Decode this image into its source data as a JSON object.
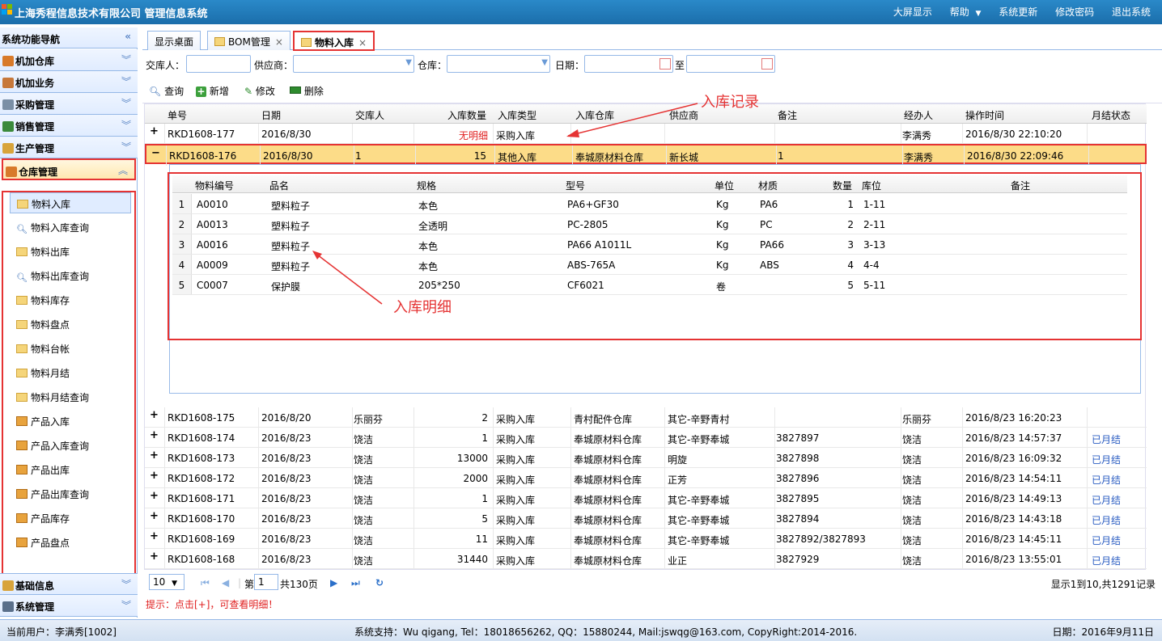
{
  "app": {
    "title": "上海秀程信息技术有限公司 管理信息系统",
    "menu": [
      "大屏显示",
      "帮助",
      "系统更新",
      "修改密码",
      "退出系统"
    ]
  },
  "sidebar": {
    "header": "系统功能导航",
    "collapse_glyph": "«",
    "categories": [
      {
        "label": "机加仓库",
        "icon": "house-icon",
        "color": "#d87a2a"
      },
      {
        "label": "机加业务",
        "icon": "wrench-icon",
        "color": "#c7783a"
      },
      {
        "label": "采购管理",
        "icon": "cart-icon",
        "color": "#7a8fa6"
      },
      {
        "label": "销售管理",
        "icon": "sales-icon",
        "color": "#3b8a3b"
      },
      {
        "label": "生产管理",
        "icon": "production-icon",
        "color": "#d8a43b"
      },
      {
        "label": "仓库管理",
        "icon": "warehouse-icon",
        "color": "#d87a2a"
      }
    ],
    "items": [
      {
        "label": "物料入库",
        "icon": "folder-icon"
      },
      {
        "label": "物料入库查询",
        "icon": "magnifier-icon"
      },
      {
        "label": "物料出库",
        "icon": "folder-icon"
      },
      {
        "label": "物料出库查询",
        "icon": "magnifier-icon"
      },
      {
        "label": "物料库存",
        "icon": "folder-icon"
      },
      {
        "label": "物料盘点",
        "icon": "folder-icon"
      },
      {
        "label": "物料台帐",
        "icon": "folder-icon"
      },
      {
        "label": "物料月结",
        "icon": "folder-icon"
      },
      {
        "label": "物料月结查询",
        "icon": "folder-icon"
      },
      {
        "label": "产品入库",
        "icon": "product-icon"
      },
      {
        "label": "产品入库查询",
        "icon": "product-icon"
      },
      {
        "label": "产品出库",
        "icon": "product-icon"
      },
      {
        "label": "产品出库查询",
        "icon": "product-icon"
      },
      {
        "label": "产品库存",
        "icon": "product-icon"
      },
      {
        "label": "产品盘点",
        "icon": "product-icon"
      }
    ],
    "bottom_categories": [
      {
        "label": "基础信息",
        "icon": "key-icon",
        "color": "#d8a43b"
      },
      {
        "label": "系统管理",
        "icon": "monitor-icon",
        "color": "#5a6f8a"
      }
    ]
  },
  "tabs": [
    {
      "label": "显示桌面",
      "closable": false
    },
    {
      "label": "BOM管理",
      "closable": true
    },
    {
      "label": "物料入库",
      "closable": true
    }
  ],
  "filters": {
    "deliverer_label": "交库人：",
    "supplier_label": "供应商：",
    "warehouse_label": "仓库：",
    "date_label": "日期：",
    "to_label": "至"
  },
  "toolbar": [
    "查询",
    "新增",
    "修改",
    "删除"
  ],
  "grid": {
    "columns": [
      "单号",
      "日期",
      "交库人",
      "入库数量",
      "入库类型",
      "入库仓库",
      "供应商",
      "备注",
      "经办人",
      "操作时间",
      "月结状态"
    ],
    "rows": [
      {
        "no": "RKD1608-177",
        "date": "2016/8/30",
        "person": "",
        "qty": "无明细",
        "type": "采购入库",
        "wh": "",
        "supplier": "",
        "note": "",
        "handler": "李满秀",
        "time": "2016/8/30 22:10:20",
        "status": ""
      },
      {
        "no": "RKD1608-176",
        "date": "2016/8/30",
        "person": "1",
        "qty": "15",
        "type": "其他入库",
        "wh": "奉城原材料仓库",
        "supplier": "新长城",
        "note": "1",
        "handler": "李满秀",
        "time": "2016/8/30 22:09:46",
        "status": ""
      },
      {
        "no": "RKD1608-175",
        "date": "2016/8/20",
        "person": "乐丽芬",
        "qty": "2",
        "type": "采购入库",
        "wh": "青村配件仓库",
        "supplier": "其它-辛野青村",
        "note": "",
        "handler": "乐丽芬",
        "time": "2016/8/23 16:20:23",
        "status": ""
      },
      {
        "no": "RKD1608-174",
        "date": "2016/8/23",
        "person": "饶洁",
        "qty": "1",
        "type": "采购入库",
        "wh": "奉城原材料仓库",
        "supplier": "其它-辛野奉城",
        "note": "3827897",
        "handler": "饶洁",
        "time": "2016/8/23 14:57:37",
        "status": "已月结"
      },
      {
        "no": "RKD1608-173",
        "date": "2016/8/23",
        "person": "饶洁",
        "qty": "13000",
        "type": "采购入库",
        "wh": "奉城原材料仓库",
        "supplier": "明旋",
        "note": "3827898",
        "handler": "饶洁",
        "time": "2016/8/23 16:09:32",
        "status": "已月结"
      },
      {
        "no": "RKD1608-172",
        "date": "2016/8/23",
        "person": "饶洁",
        "qty": "2000",
        "type": "采购入库",
        "wh": "奉城原材料仓库",
        "supplier": "正芳",
        "note": "3827896",
        "handler": "饶洁",
        "time": "2016/8/23 14:54:11",
        "status": "已月结"
      },
      {
        "no": "RKD1608-171",
        "date": "2016/8/23",
        "person": "饶洁",
        "qty": "1",
        "type": "采购入库",
        "wh": "奉城原材料仓库",
        "supplier": "其它-辛野奉城",
        "note": "3827895",
        "handler": "饶洁",
        "time": "2016/8/23 14:49:13",
        "status": "已月结"
      },
      {
        "no": "RKD1608-170",
        "date": "2016/8/23",
        "person": "饶洁",
        "qty": "5",
        "type": "采购入库",
        "wh": "奉城原材料仓库",
        "supplier": "其它-辛野奉城",
        "note": "3827894",
        "handler": "饶洁",
        "time": "2016/8/23 14:43:18",
        "status": "已月结"
      },
      {
        "no": "RKD1608-169",
        "date": "2016/8/23",
        "person": "饶洁",
        "qty": "11",
        "type": "采购入库",
        "wh": "奉城原材料仓库",
        "supplier": "其它-辛野奉城",
        "note": "3827892/3827893",
        "handler": "饶洁",
        "time": "2016/8/23 14:45:11",
        "status": "已月结"
      },
      {
        "no": "RKD1608-168",
        "date": "2016/8/23",
        "person": "饶洁",
        "qty": "31440",
        "type": "采购入库",
        "wh": "奉城原材料仓库",
        "supplier": "业正",
        "note": "3827929",
        "handler": "饶洁",
        "time": "2016/8/23 13:55:01",
        "status": "已月结"
      }
    ],
    "detail_columns": [
      "物料编号",
      "品名",
      "规格",
      "型号",
      "单位",
      "材质",
      "数量",
      "库位",
      "备注"
    ],
    "detail_rows": [
      {
        "n": "1",
        "code": "A0010",
        "name": "塑料粒子",
        "spec": "本色",
        "model": "PA6+GF30",
        "unit": "Kg",
        "mat": "PA6",
        "qty": "1",
        "loc": "1-11",
        "note": ""
      },
      {
        "n": "2",
        "code": "A0013",
        "name": "塑料粒子",
        "spec": "全透明",
        "model": "PC-2805",
        "unit": "Kg",
        "mat": "PC",
        "qty": "2",
        "loc": "2-11",
        "note": ""
      },
      {
        "n": "3",
        "code": "A0016",
        "name": "塑料粒子",
        "spec": "本色",
        "model": "PA66 A1011L",
        "unit": "Kg",
        "mat": "PA66",
        "qty": "3",
        "loc": "3-13",
        "note": ""
      },
      {
        "n": "4",
        "code": "A0009",
        "name": "塑料粒子",
        "spec": "本色",
        "model": "ABS-765A",
        "unit": "Kg",
        "mat": "ABS",
        "qty": "4",
        "loc": "4-4",
        "note": ""
      },
      {
        "n": "5",
        "code": "C0007",
        "name": "保护膜",
        "spec": "205*250",
        "model": "CF6021",
        "unit": "卷",
        "mat": "",
        "qty": "5",
        "loc": "5-11",
        "note": ""
      }
    ]
  },
  "pager": {
    "page_size": "10",
    "page_prefix": "第",
    "page_value": "1",
    "page_total": "共130页",
    "summary": "显示1到10,共1291记录"
  },
  "tip": "提示：点击[+]，可查看明细！",
  "annotations": {
    "records": "入库记录",
    "details": "入库明细"
  },
  "footer": {
    "user": "当前用户：李满秀[1002]",
    "support": "系统支持：Wu qigang, Tel：18018656262, QQ：15880244, Mail:jswqg@163.com, CopyRight:2014-2016.",
    "date": "日期：2016年9月11日"
  },
  "colors": {
    "accent": "#1b6eab",
    "highlight": "#fcdc88",
    "annotation": "#e53333",
    "monthly_closed": "#2a5cc2"
  }
}
